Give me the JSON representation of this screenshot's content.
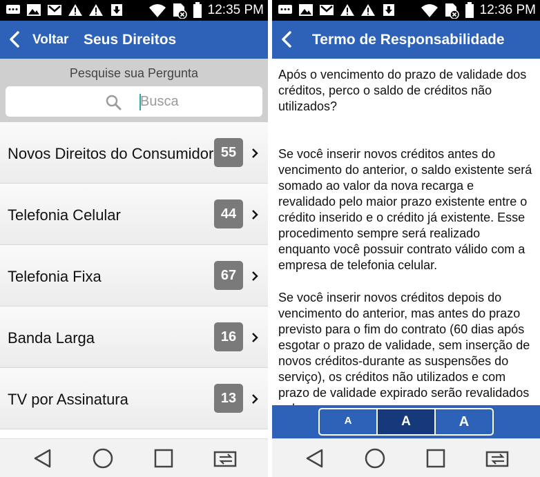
{
  "left": {
    "status_time": "12:35 PM",
    "header": {
      "back_label": "Voltar",
      "title": "Seus Direitos"
    },
    "search": {
      "caption": "Pesquise sua Pergunta",
      "placeholder": "Busca"
    },
    "items": [
      {
        "label": "Novos Direitos do Consumidor",
        "count": "55"
      },
      {
        "label": "Telefonia Celular",
        "count": "44"
      },
      {
        "label": "Telefonia Fixa",
        "count": "67"
      },
      {
        "label": "Banda Larga",
        "count": "16"
      },
      {
        "label": "TV por Assinatura",
        "count": "13"
      }
    ]
  },
  "right": {
    "status_time": "12:36 PM",
    "header": {
      "title": "Termo de Responsabilidade"
    },
    "paragraphs": [
      "Após o vencimento do prazo de validade dos créditos, perco o saldo de créditos não utilizados?",
      "Se você inserir novos créditos antes do vencimento do anterior, o saldo existente será somado ao valor da nova recarga e revalidado pelo maior prazo existente entre o crédito inserido e o crédito já existente. Esse procedimento sempre será realizado enquanto você possuir contrato válido com a empresa de telefonia celular.",
      "Se você inserir novos créditos depois do vencimento do anterior, mas antes do prazo previsto para o fim do contrato (60 dias após esgotar o prazo de validade, sem inserção de novos créditos-durante as suspensões do serviço), os créditos não utilizados e com prazo de validade expirado serão revalidados pelo mesmo"
    ],
    "font_size_options": [
      {
        "label": "A",
        "size": "small",
        "active": false
      },
      {
        "label": "A",
        "size": "medium",
        "active": true
      },
      {
        "label": "A",
        "size": "large",
        "active": false
      }
    ]
  },
  "colors": {
    "header_blue": "#2e62b8",
    "active_segment": "#15397b",
    "badge_gray": "#7a7a7a",
    "search_bg": "#cfcfcf"
  },
  "icons": {
    "status": [
      "message-icon",
      "image-icon",
      "gmail-icon",
      "alert-icon",
      "alert-icon",
      "download-icon",
      "wifi-icon",
      "sim-icon",
      "battery-icon"
    ],
    "nav": [
      "back-triangle-icon",
      "home-circle-icon",
      "recents-square-icon",
      "switch-app-icon"
    ],
    "list_item": "chevron-right-icon",
    "search": "magnifier-icon"
  }
}
